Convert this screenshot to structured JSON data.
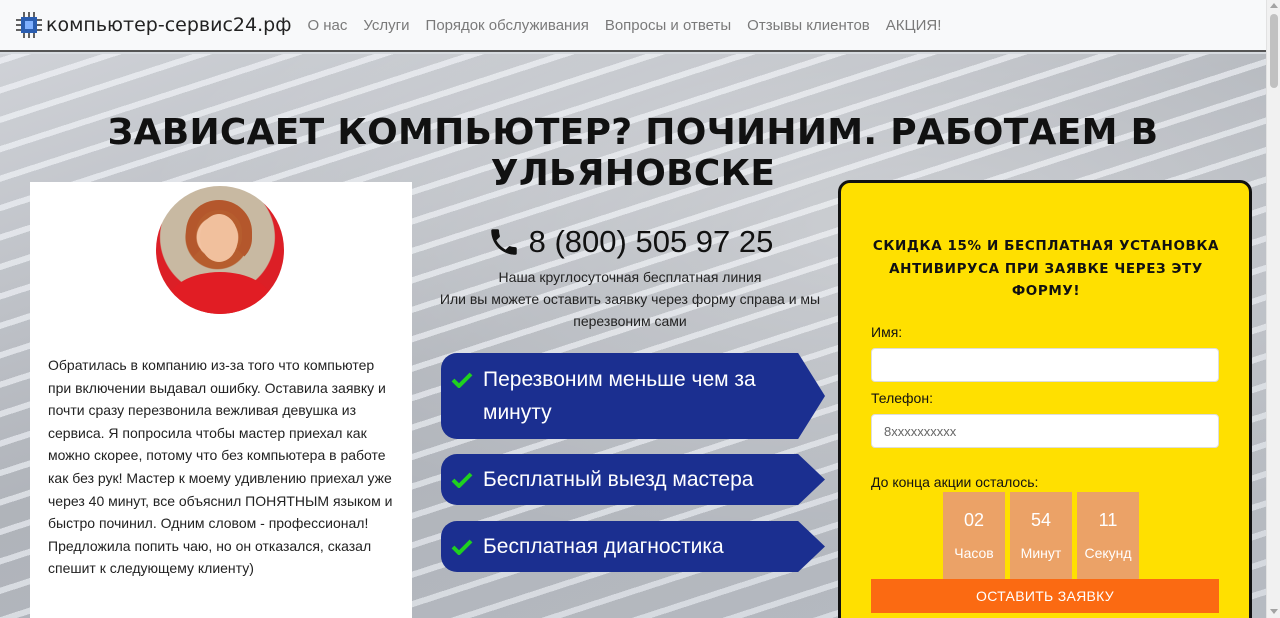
{
  "navbar": {
    "brand": "компьютер-сервис24.рф",
    "links": [
      "О нас",
      "Услуги",
      "Порядок обслуживания",
      "Вопросы и ответы",
      "Отзывы клиентов",
      "АКЦИЯ!"
    ]
  },
  "hero": {
    "title": "ЗАВИСАЕТ КОМПЬЮТЕР? ПОЧИНИМ. РАБОТАЕМ В УЛЬЯНОВСКЕ"
  },
  "testimonial": {
    "text": "Обратилась в компанию из-за того что компьютер при включении выдавал ошибку. Оставила заявку и почти сразу перезвонила вежливая девушка из сервиса. Я попросила чтобы мастер приехал как можно скорее, потому что без компьютера в работе как без рук! Мастер к моему удивлению приехал уже через 40 минут, все объяснил ПОНЯТНЫМ языком и быстро починил. Одним словом - профессионал! Предложила попить чаю, но он отказался, сказал спешит к следующему клиенту)"
  },
  "contact": {
    "phone": "8 (800) 505 97 25",
    "line1": "Наша круглосуточная бесплатная линия",
    "line2": "Или вы можете оставить заявку через форму справа и мы перезвоним сами"
  },
  "features": [
    "Перезвоним меньше чем за минуту",
    "Бесплатный выезд мастера",
    "Бесплатная диагностика"
  ],
  "form": {
    "promo": "СКИДКА 15% И БЕСПЛАТНАЯ УСТАНОВКА АНТИВИРУСА ПРИ ЗАЯВКЕ ЧЕРЕЗ ЭТУ ФОРМУ!",
    "name_label": "Имя:",
    "phone_label": "Телефон:",
    "phone_placeholder": "8xxxxxxxxxx",
    "timer_label": "До конца акции осталось:",
    "timer": [
      {
        "value": "02",
        "unit": "Часов"
      },
      {
        "value": "54",
        "unit": "Минут"
      },
      {
        "value": "11",
        "unit": "Секунд"
      }
    ],
    "submit": "ОСТАВИТЬ ЗАЯВКУ"
  },
  "colors": {
    "feature_bg": "#1b2f90",
    "check": "#1fd11f",
    "form_bg": "#ffe000",
    "timer_bg": "#eba267",
    "submit_bg": "#fb6a12"
  }
}
